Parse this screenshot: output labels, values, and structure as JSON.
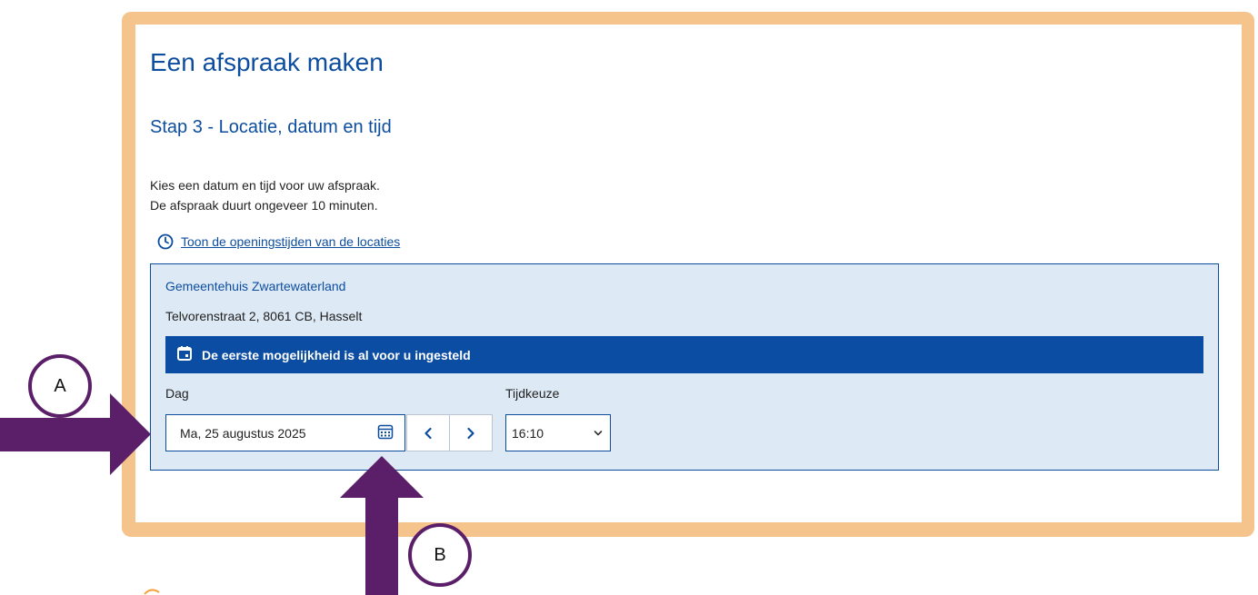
{
  "page": {
    "title": "Een afspraak maken",
    "step_title": "Stap 3 - Locatie, datum en tijd",
    "intro_line1": "Kies een datum en tijd voor uw afspraak.",
    "intro_line2": "De afspraak duurt ongeveer 10 minuten.",
    "opening_hours_link": "Toon de openingstijden van de locaties"
  },
  "location": {
    "name": "Gemeentehuis Zwartewaterland",
    "address": "Telvorenstraat 2, 8061 CB, Hasselt",
    "notice": "De eerste mogelijkheid is al voor u ingesteld"
  },
  "form": {
    "day_label": "Dag",
    "day_value": "Ma, 25 augustus 2025",
    "prev_label": "‹",
    "next_label": "›",
    "time_label": "Tijdkeuze",
    "time_value": "16:10"
  },
  "callouts": {
    "a": "A",
    "b": "B"
  },
  "colors": {
    "frame": "#f4c48c",
    "heading": "#0d4d9e",
    "location_bg": "#dde9f5",
    "notice_bg": "#0b4da2",
    "arrow": "#5b1f6a"
  },
  "icons": [
    "clock-icon",
    "calendar-icon",
    "calendar-grid-icon",
    "chevron-left-icon",
    "chevron-right-icon",
    "chevron-down-icon"
  ]
}
